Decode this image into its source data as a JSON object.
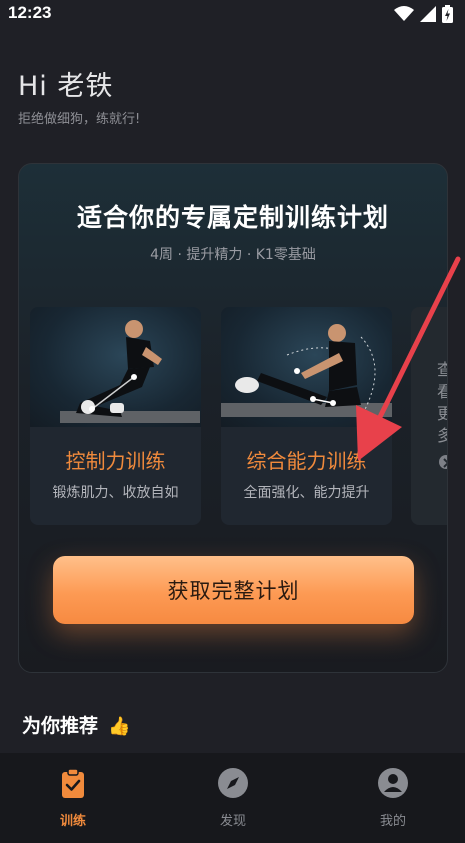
{
  "status_bar": {
    "time": "12:23"
  },
  "header": {
    "greeting": "Hi 老铁",
    "subtitle": "拒绝做细狗，练就行!"
  },
  "plan_card": {
    "title": "适合你的专属定制训练计划",
    "meta": "4周 · 提升精力 · K1零基础",
    "trainings": [
      {
        "name": "控制力训练",
        "desc": "锻炼肌力、收放自如"
      },
      {
        "name": "综合能力训练",
        "desc": "全面强化、能力提升"
      }
    ],
    "more_label": "查看更多",
    "cta_label": "获取完整计划"
  },
  "recommend": {
    "title": "为你推荐",
    "emoji": "👍"
  },
  "bottom_nav": [
    {
      "label": "训练",
      "icon": "clipboard-check-icon",
      "active": true
    },
    {
      "label": "发现",
      "icon": "compass-icon",
      "active": false
    },
    {
      "label": "我的",
      "icon": "user-icon",
      "active": false
    }
  ],
  "colors": {
    "accent": "#f08a3c",
    "background": "#1f2026",
    "annotation": "#e8414b"
  }
}
